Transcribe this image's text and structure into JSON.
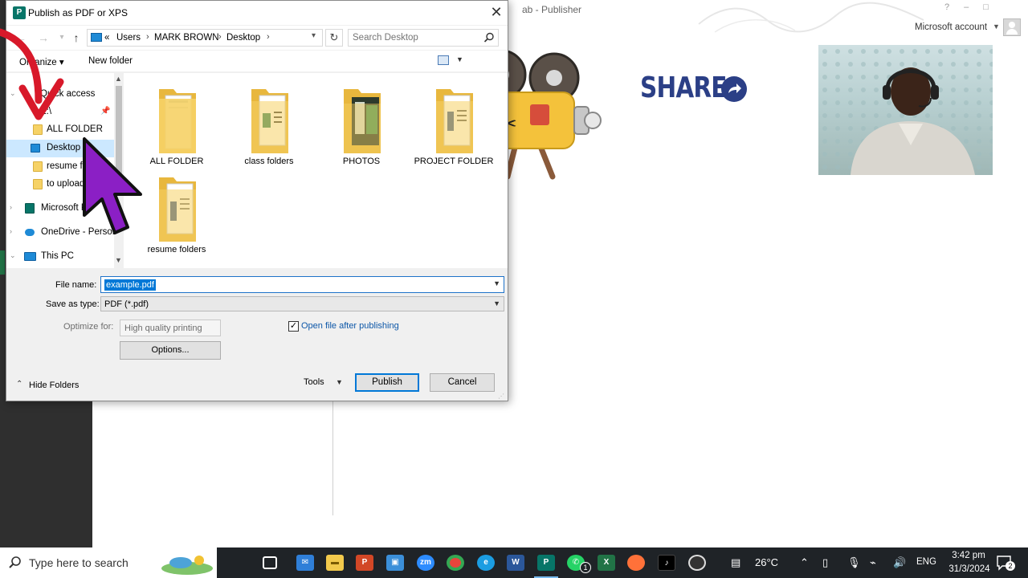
{
  "background_app": {
    "title_fragment": "ab - Publisher",
    "account_label": "Microsoft account",
    "share_label": "SHARE"
  },
  "dialog": {
    "title": "Publish as PDF or XPS",
    "breadcrumb": [
      "«",
      "Users",
      "MARK BROWN",
      "Desktop"
    ],
    "search_placeholder": "Search Desktop",
    "toolbar": {
      "organize": "Organize",
      "new_folder": "New folder"
    },
    "nav_pane": [
      {
        "label": "Quick access",
        "type": "header"
      },
      {
        "label": "E:\\",
        "type": "drive"
      },
      {
        "label": "ALL FOLDER",
        "type": "folder"
      },
      {
        "label": "Desktop",
        "type": "desktop",
        "selected": true
      },
      {
        "label": "resume fo",
        "type": "folder"
      },
      {
        "label": "to upload",
        "type": "folder"
      },
      {
        "label": "Microsoft Pu",
        "type": "app"
      },
      {
        "label": "OneDrive - Person",
        "type": "cloud"
      },
      {
        "label": "This PC",
        "type": "pc"
      }
    ],
    "folders": [
      {
        "name": "ALL FOLDER"
      },
      {
        "name": "class folders"
      },
      {
        "name": "PHOTOS"
      },
      {
        "name": "PROJECT FOLDER"
      },
      {
        "name": "resume folders"
      }
    ],
    "form": {
      "file_name_label": "File name:",
      "file_name_value": "example.pdf",
      "save_type_label": "Save as type:",
      "save_type_value": "PDF (*.pdf)",
      "optimize_label": "Optimize for:",
      "optimize_value": "High quality printing",
      "options_button": "Options...",
      "open_after_label": "Open file after publishing",
      "open_after_checked": true
    },
    "footer": {
      "hide_folders": "Hide Folders",
      "tools": "Tools",
      "publish": "Publish",
      "cancel": "Cancel"
    }
  },
  "taskbar": {
    "search_placeholder": "Type here to search",
    "apps": [
      "task-view",
      "mail",
      "file-explorer",
      "powerpoint",
      "store",
      "zoom",
      "chrome",
      "edge",
      "word",
      "publisher",
      "whatsapp",
      "excel",
      "firefox",
      "tiktok",
      "screen-recorder"
    ],
    "whatsapp_badge": "1",
    "weather": "26°C",
    "language": "ENG",
    "time": "3:42 pm",
    "date": "31/3/2024",
    "notification_count": "2",
    "colors": {
      "taskbar_bg": "#1f2327",
      "accent": "#0078d7"
    }
  }
}
